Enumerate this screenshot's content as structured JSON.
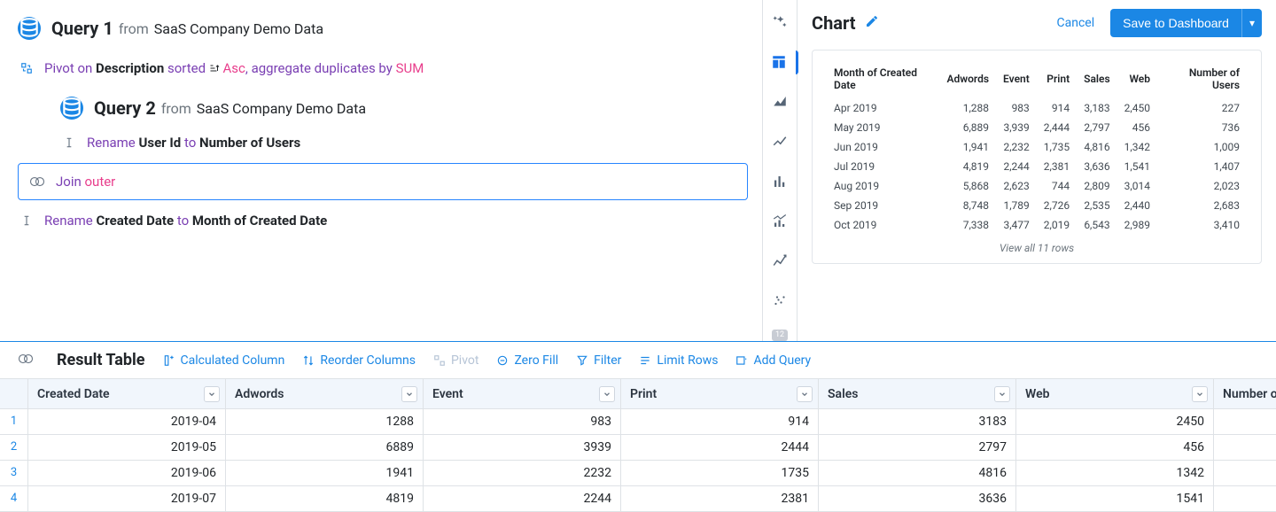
{
  "query1": {
    "title": "Query 1",
    "from_label": "from",
    "source": "SaaS Company Demo Data",
    "pivot": {
      "prefix": "Pivot on",
      "column": "Description",
      "sorted_label": "sorted",
      "direction": "Asc",
      "aggregate_label": ", aggregate duplicates by",
      "aggregate_fn": "SUM"
    },
    "rename": {
      "prefix": "Rename",
      "from": "Created Date",
      "to_label": "to",
      "to": "Month of Created Date"
    }
  },
  "query2": {
    "title": "Query 2",
    "from_label": "from",
    "source": "SaaS Company Demo Data",
    "rename": {
      "prefix": "Rename",
      "from": "User Id",
      "to_label": "to",
      "to": "Number of Users"
    },
    "join": {
      "label": "Join",
      "type": "outer"
    }
  },
  "chart": {
    "title": "Chart",
    "cancel": "Cancel",
    "save": "Save to Dashboard",
    "view_all": "View all 11 rows",
    "headers": [
      "Month of Created Date",
      "Adwords",
      "Event",
      "Print",
      "Sales",
      "Web",
      "Number of Users"
    ],
    "rows": [
      [
        "Apr 2019",
        "1,288",
        "983",
        "914",
        "3,183",
        "2,450",
        "227"
      ],
      [
        "May 2019",
        "6,889",
        "3,939",
        "2,444",
        "2,797",
        "456",
        "736"
      ],
      [
        "Jun 2019",
        "1,941",
        "2,232",
        "1,735",
        "4,816",
        "1,342",
        "1,009"
      ],
      [
        "Jul 2019",
        "4,819",
        "2,244",
        "2,381",
        "3,636",
        "1,541",
        "1,407"
      ],
      [
        "Aug 2019",
        "5,868",
        "2,623",
        "744",
        "2,809",
        "3,014",
        "2,023"
      ],
      [
        "Sep 2019",
        "8,748",
        "1,789",
        "2,726",
        "2,535",
        "2,440",
        "2,683"
      ],
      [
        "Oct 2019",
        "7,338",
        "3,477",
        "2,019",
        "6,543",
        "2,989",
        "3,410"
      ]
    ],
    "rail_number": "12"
  },
  "results": {
    "title": "Result Table",
    "toolbar": {
      "calculated": "Calculated Column",
      "reorder": "Reorder Columns",
      "pivot": "Pivot",
      "zerofill": "Zero Fill",
      "filter": "Filter",
      "limit": "Limit Rows",
      "addquery": "Add Query"
    },
    "headers": [
      "Created Date",
      "Adwords",
      "Event",
      "Print",
      "Sales",
      "Web",
      "Number of Users"
    ],
    "rows": [
      [
        "1",
        "2019-04",
        "1288",
        "983",
        "914",
        "3183",
        "2450"
      ],
      [
        "2",
        "2019-05",
        "6889",
        "3939",
        "2444",
        "2797",
        "456"
      ],
      [
        "3",
        "2019-06",
        "1941",
        "2232",
        "1735",
        "4816",
        "1342"
      ],
      [
        "4",
        "2019-07",
        "4819",
        "2244",
        "2381",
        "3636",
        "1541"
      ]
    ],
    "last_col_truncated": "Number o"
  }
}
